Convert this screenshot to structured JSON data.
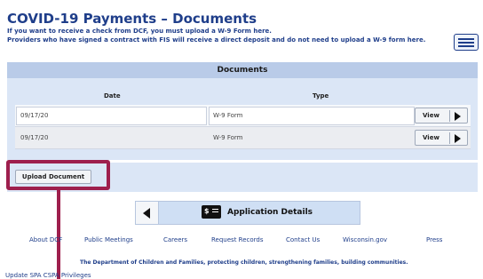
{
  "header": {
    "title": "COVID-19 Payments – Documents",
    "line1": "If you want to receive a check from DCF, you must upload a W-9 Form here.",
    "line2": "Providers who have signed a contract with FIS will receive a direct deposit and do not need to upload a W-9 form here."
  },
  "documents": {
    "title": "Documents",
    "columns": [
      "Date",
      "Type"
    ],
    "rows": [
      {
        "date": "09/17/20",
        "type": "W-9 Form",
        "action": "View"
      },
      {
        "date": "09/17/20",
        "type": "W-9 Form",
        "action": "View"
      }
    ]
  },
  "upload": {
    "label": "Upload Document"
  },
  "nav": {
    "app_label": "Application Details",
    "icon_glyph": "$"
  },
  "footer": {
    "links": [
      "About DCF",
      "Public Meetings",
      "Careers",
      "Request Records",
      "Contact Us",
      "Wisconsin.gov",
      "Press"
    ],
    "tagline": "The Department of Children and Families, protecting children, strengthening families, building communities.",
    "update_link": "Update SPA CSPA Privileges"
  },
  "colors": {
    "brand": "#1f3e8a",
    "highlight": "#9e1f4d",
    "panel": "#dbe6f6"
  }
}
